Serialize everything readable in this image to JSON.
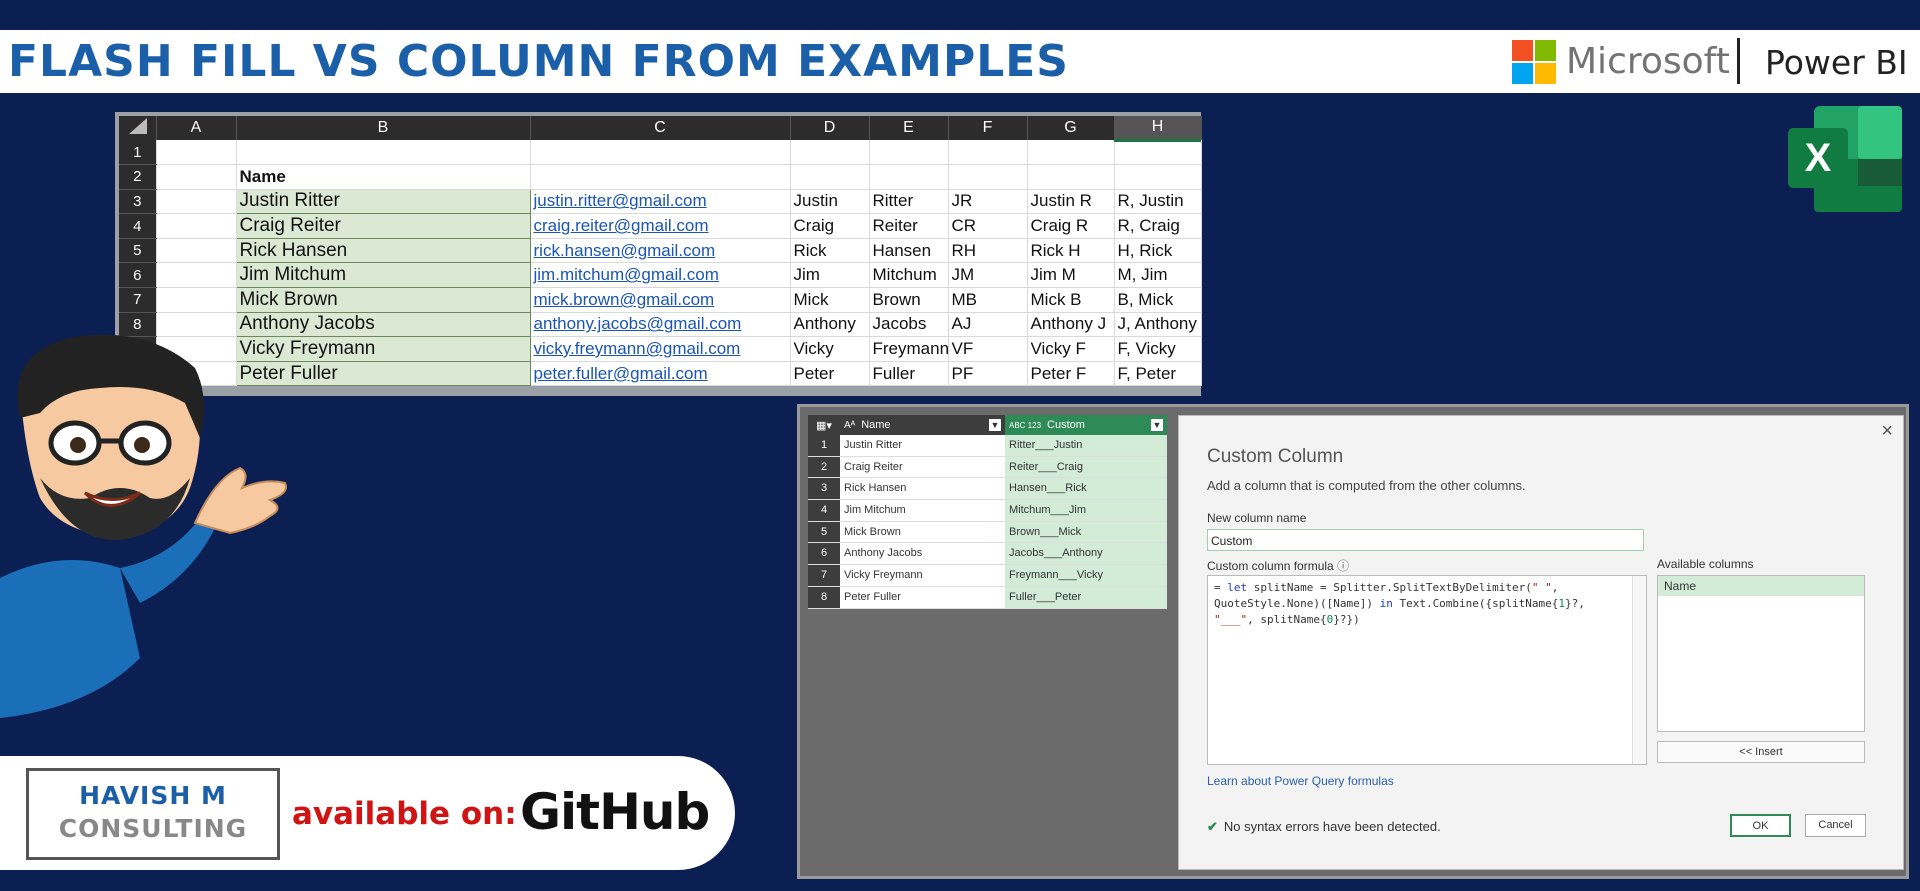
{
  "banner": {
    "title": "FLASH FILL VS COLUMN FROM EXAMPLES",
    "brand_text": "Microsoft",
    "product_text": "Power BI",
    "colors": {
      "title": "#1b5fa8",
      "background": "#0c1f52"
    }
  },
  "spreadsheet": {
    "columns": [
      "A",
      "B",
      "C",
      "D",
      "E",
      "F",
      "G",
      "H"
    ],
    "header_label": "Name",
    "rows": [
      {
        "n": "1",
        "name": "",
        "email": "",
        "first": "",
        "last": "",
        "initials": "",
        "first_li": "",
        "last_first": ""
      },
      {
        "n": "2",
        "name": "",
        "email": "",
        "first": "",
        "last": "",
        "initials": "",
        "first_li": "",
        "last_first": ""
      },
      {
        "n": "3",
        "name": "Justin Ritter",
        "email": "justin.ritter@gmail.com",
        "first": "Justin",
        "last": "Ritter",
        "initials": "JR",
        "first_li": "Justin R",
        "last_first": "R, Justin"
      },
      {
        "n": "4",
        "name": "Craig Reiter",
        "email": "craig.reiter@gmail.com",
        "first": "Craig",
        "last": "Reiter",
        "initials": "CR",
        "first_li": "Craig R",
        "last_first": "R, Craig"
      },
      {
        "n": "5",
        "name": "Rick Hansen",
        "email": "rick.hansen@gmail.com",
        "first": "Rick",
        "last": "Hansen",
        "initials": "RH",
        "first_li": "Rick H",
        "last_first": "H, Rick"
      },
      {
        "n": "6",
        "name": "Jim Mitchum",
        "email": "jim.mitchum@gmail.com",
        "first": "Jim",
        "last": "Mitchum",
        "initials": "JM",
        "first_li": "Jim M",
        "last_first": "M, Jim"
      },
      {
        "n": "7",
        "name": "Mick Brown",
        "email": "mick.brown@gmail.com",
        "first": "Mick",
        "last": "Brown",
        "initials": "MB",
        "first_li": "Mick B",
        "last_first": "B, Mick"
      },
      {
        "n": "8",
        "name": "Anthony Jacobs",
        "email": "anthony.jacobs@gmail.com",
        "first": "Anthony",
        "last": "Jacobs",
        "initials": "AJ",
        "first_li": "Anthony J",
        "last_first": "J, Anthony"
      },
      {
        "n": "",
        "name": "Vicky Freymann",
        "email": "vicky.freymann@gmail.com",
        "first": "Vicky",
        "last": "Freymann",
        "initials": "VF",
        "first_li": "Vicky F",
        "last_first": "F, Vicky"
      },
      {
        "n": "",
        "name": "Peter Fuller",
        "email": "peter.fuller@gmail.com",
        "first": "Peter",
        "last": "Fuller",
        "initials": "PF",
        "first_li": "Peter F",
        "last_first": "F, Peter"
      }
    ]
  },
  "query_grid": {
    "col1_type": "Aᴬ",
    "col1_header": "Name",
    "col2_type": "ABC 123",
    "col2_header": "Custom",
    "rows": [
      {
        "n": "1",
        "name": "Justin Ritter",
        "custom": "Ritter___Justin"
      },
      {
        "n": "2",
        "name": "Craig Reiter",
        "custom": "Reiter___Craig"
      },
      {
        "n": "3",
        "name": "Rick Hansen",
        "custom": "Hansen___Rick"
      },
      {
        "n": "4",
        "name": "Jim Mitchum",
        "custom": "Mitchum___Jim"
      },
      {
        "n": "5",
        "name": "Mick Brown",
        "custom": "Brown___Mick"
      },
      {
        "n": "6",
        "name": "Anthony Jacobs",
        "custom": "Jacobs___Anthony"
      },
      {
        "n": "7",
        "name": "Vicky Freymann",
        "custom": "Freymann___Vicky"
      },
      {
        "n": "8",
        "name": "Peter Fuller",
        "custom": "Fuller___Peter"
      }
    ]
  },
  "dialog": {
    "title": "Custom Column",
    "subtitle": "Add a column that is computed from the other columns.",
    "name_label": "New column name",
    "name_value": "Custom",
    "formula_label": "Custom column formula",
    "available_label": "Available columns",
    "available_items": [
      "Name"
    ],
    "insert_label": "<< Insert",
    "learn_link": "Learn about Power Query formulas",
    "status": "No syntax errors have been detected.",
    "ok_label": "OK",
    "cancel_label": "Cancel"
  },
  "credits": {
    "line1": "HAVISH M",
    "line2": "CONSULTING",
    "available": "available on:",
    "platform": "GitHub"
  },
  "icons": {
    "excel": "X",
    "close": "×",
    "check": "✔",
    "info": "ⓘ"
  }
}
